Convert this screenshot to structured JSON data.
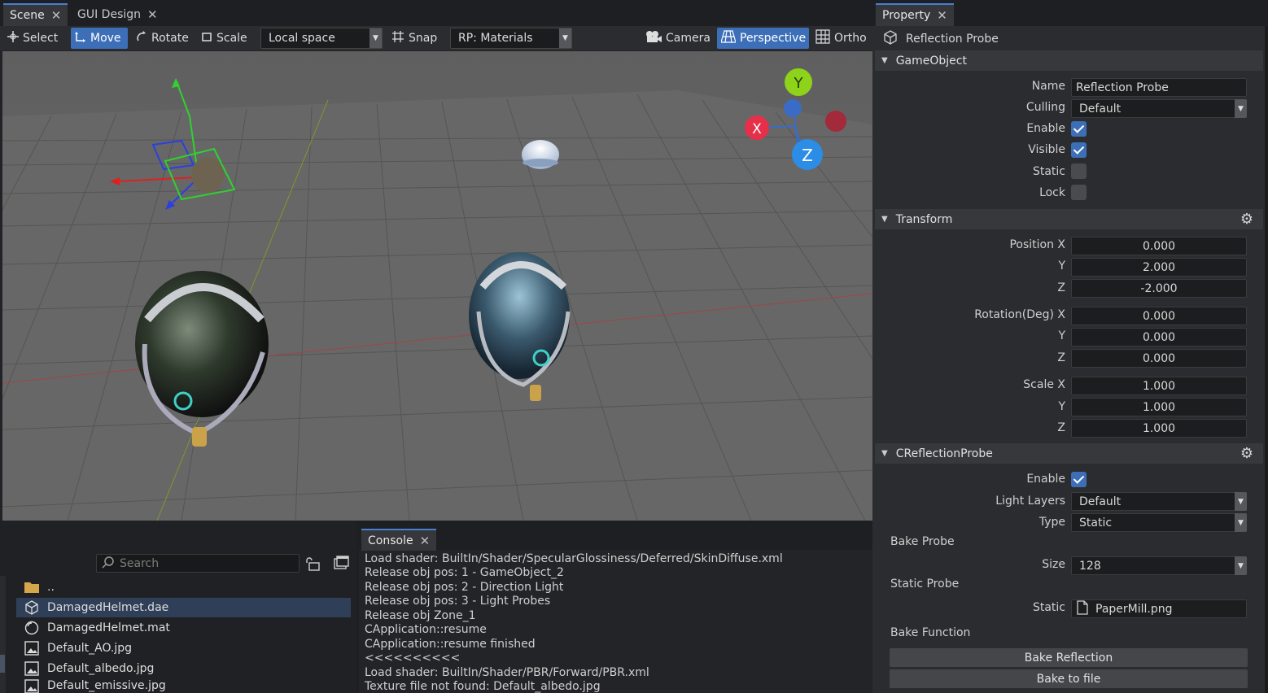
{
  "scene_tabs": [
    {
      "label": "Scene",
      "active": true
    },
    {
      "label": "GUI Design",
      "active": false
    }
  ],
  "toolbar": {
    "select": "Select",
    "move": "Move",
    "rotate": "Rotate",
    "scale": "Scale",
    "space": "Local space",
    "snap": "Snap",
    "render_path": "RP: Materials",
    "camera": "Camera",
    "perspective": "Perspective",
    "ortho": "Ortho"
  },
  "gizmo": {
    "y": "Y",
    "x": "X",
    "z": "Z"
  },
  "property": {
    "tab": "Property",
    "object_title": "Reflection Probe",
    "sections": {
      "gameobject": "GameObject",
      "transform": "Transform",
      "probe": "CReflectionProbe"
    },
    "gameobject": {
      "name_label": "Name",
      "name_value": "Reflection Probe",
      "culling_label": "Culling",
      "culling_value": "Default",
      "enable_label": "Enable",
      "enable": true,
      "visible_label": "Visible",
      "visible": true,
      "static_label": "Static",
      "static": false,
      "lock_label": "Lock",
      "lock": false
    },
    "transform": {
      "position_label": "Position X",
      "rotation_label": "Rotation(Deg) X",
      "scale_label": "Scale X",
      "y_label": "Y",
      "z_label": "Z",
      "position": [
        "0.000",
        "2.000",
        "-2.000"
      ],
      "rotation": [
        "0.000",
        "0.000",
        "0.000"
      ],
      "scale": [
        "1.000",
        "1.000",
        "1.000"
      ]
    },
    "probe": {
      "enable_label": "Enable",
      "enable": true,
      "light_layers_label": "Light Layers",
      "light_layers_value": "Default",
      "type_label": "Type",
      "type_value": "Static",
      "bake_probe": "Bake Probe",
      "size_label": "Size",
      "size_value": "128",
      "static_probe": "Static Probe",
      "static_label": "Static",
      "static_value": "PaperMill.png",
      "bake_function": "Bake Function",
      "bake_reflection": "Bake Reflection",
      "bake_to_file": "Bake to file"
    }
  },
  "assets": {
    "search_placeholder": "Search",
    "items": [
      {
        "name": "..",
        "icon": "folder-icon"
      },
      {
        "name": "DamagedHelmet.dae",
        "icon": "cube-icon"
      },
      {
        "name": "DamagedHelmet.mat",
        "icon": "material-icon"
      },
      {
        "name": "Default_AO.jpg",
        "icon": "image-icon"
      },
      {
        "name": "Default_albedo.jpg",
        "icon": "image-icon"
      },
      {
        "name": "Default_emissive.jpg",
        "icon": "image-icon"
      }
    ]
  },
  "console": {
    "tab": "Console",
    "lines": [
      "Load shader: BuiltIn/Shader/SpecularGlossiness/Deferred/SkinDiffuse.xml",
      "Release obj pos: 1 - GameObject_2",
      "Release obj pos: 2 - Direction Light",
      "Release obj pos: 3 - Light Probes",
      "Release obj Zone_1",
      "CApplication::resume",
      "CApplication::resume finished",
      "<<<<<<<<<<",
      "Load shader: BuiltIn/Shader/PBR/Forward/PBR.xml",
      "Texture file not found: Default_albedo.jpg"
    ]
  },
  "colors": {
    "accent": "#3d6fb8",
    "panel": "#2b2c2f",
    "viewport": "#6b6b6b"
  }
}
